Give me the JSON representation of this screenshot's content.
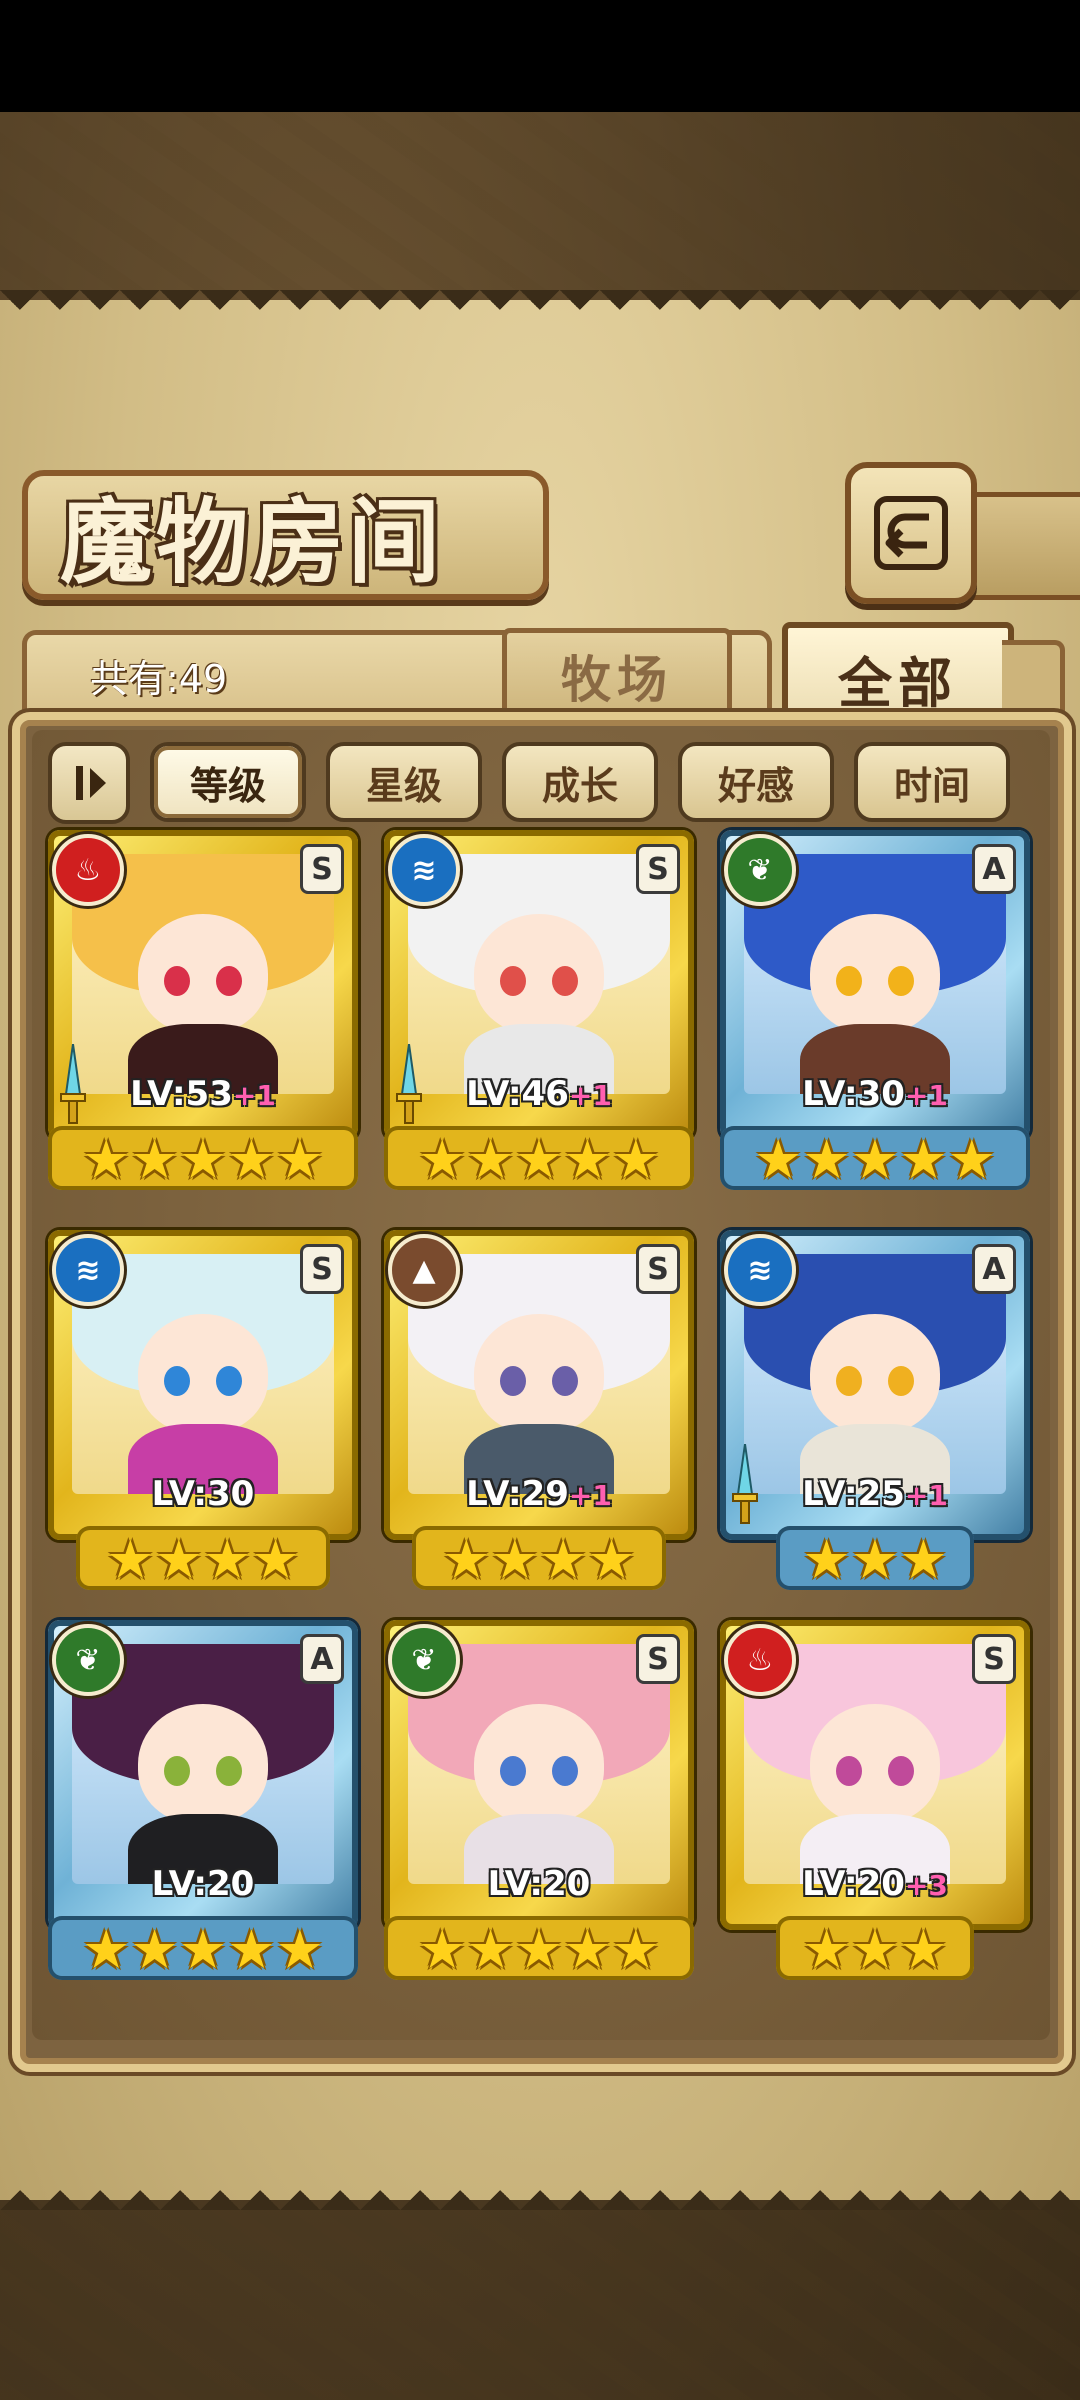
{
  "screen": {
    "title": "魔物房间",
    "count_label": "共有:49",
    "tabs": [
      {
        "label": "牧场",
        "active": false
      },
      {
        "label": "全部",
        "active": true
      }
    ],
    "sort_buttons": [
      {
        "label": "等级",
        "active": true
      },
      {
        "label": "星级",
        "active": false
      },
      {
        "label": "成长",
        "active": false
      },
      {
        "label": "好感",
        "active": false
      },
      {
        "label": "时间",
        "active": false
      }
    ]
  },
  "colors": {
    "parchment": "#d2bd86",
    "panel": "#7d6340",
    "gold_frame": "#e2b51c",
    "silver_frame": "#6fb2d6",
    "plus_text": "#ff5fb0"
  },
  "monsters": [
    {
      "element": "fire",
      "element_glyph": "♨",
      "rank": "S",
      "frame": "gold",
      "level": "LV:53",
      "plus": "+1",
      "stars": "★★★★★",
      "star_count": 5,
      "has_sword": true,
      "hair": "#f5c04a",
      "eyes": "#d9304a",
      "outfit": "#3a1b1b"
    },
    {
      "element": "water",
      "element_glyph": "≋",
      "rank": "S",
      "frame": "gold",
      "level": "LV:46",
      "plus": "+1",
      "stars": "★★★★★",
      "star_count": 5,
      "has_sword": true,
      "hair": "#f2f2f2",
      "eyes": "#e0504a",
      "outfit": "#e8e8e8"
    },
    {
      "element": "wood",
      "element_glyph": "❦",
      "rank": "A",
      "frame": "silver",
      "level": "LV:30",
      "plus": "+1",
      "stars": "★★★★★",
      "star_count": 5,
      "has_sword": false,
      "hair": "#2e5ac8",
      "eyes": "#f2b21a",
      "outfit": "#6a3b2a"
    },
    {
      "element": "water",
      "element_glyph": "≋",
      "rank": "S",
      "frame": "gold",
      "level": "LV:30",
      "plus": "",
      "stars": "★★★★",
      "star_count": 4,
      "has_sword": false,
      "hair": "#d8f0f4",
      "eyes": "#2f86d8",
      "outfit": "#c73ea6"
    },
    {
      "element": "earth",
      "element_glyph": "▲",
      "rank": "S",
      "frame": "gold",
      "level": "LV:29",
      "plus": "+1",
      "stars": "★★★★",
      "star_count": 4,
      "has_sword": false,
      "hair": "#f3f1f5",
      "eyes": "#6a5fa8",
      "outfit": "#4a5a6a"
    },
    {
      "element": "water",
      "element_glyph": "≋",
      "rank": "A",
      "frame": "silver",
      "level": "LV:25",
      "plus": "+1",
      "stars": "★★★",
      "star_count": 3,
      "has_sword": true,
      "hair": "#2a4fb0",
      "eyes": "#f0b020",
      "outfit": "#e9e4d8"
    },
    {
      "element": "wood",
      "element_glyph": "❦",
      "rank": "A",
      "frame": "silver",
      "level": "LV:20",
      "plus": "",
      "stars": "★★★★★",
      "star_count": 5,
      "has_sword": false,
      "hair": "#4a1f46",
      "eyes": "#8ab23a",
      "outfit": "#1f1f22"
    },
    {
      "element": "wood",
      "element_glyph": "❦",
      "rank": "S",
      "frame": "gold",
      "level": "LV:20",
      "plus": "",
      "stars": "★★★★★",
      "star_count": 5,
      "has_sword": false,
      "hair": "#f2a8b8",
      "eyes": "#4a7ad0",
      "outfit": "#e8e0e6"
    },
    {
      "element": "fire",
      "element_glyph": "♨",
      "rank": "S",
      "frame": "gold",
      "level": "LV:20",
      "plus": "+3",
      "stars": "★★★",
      "star_count": 3,
      "has_sword": false,
      "hair": "#f8c6dc",
      "eyes": "#c04a9a",
      "outfit": "#f4eef4"
    }
  ]
}
